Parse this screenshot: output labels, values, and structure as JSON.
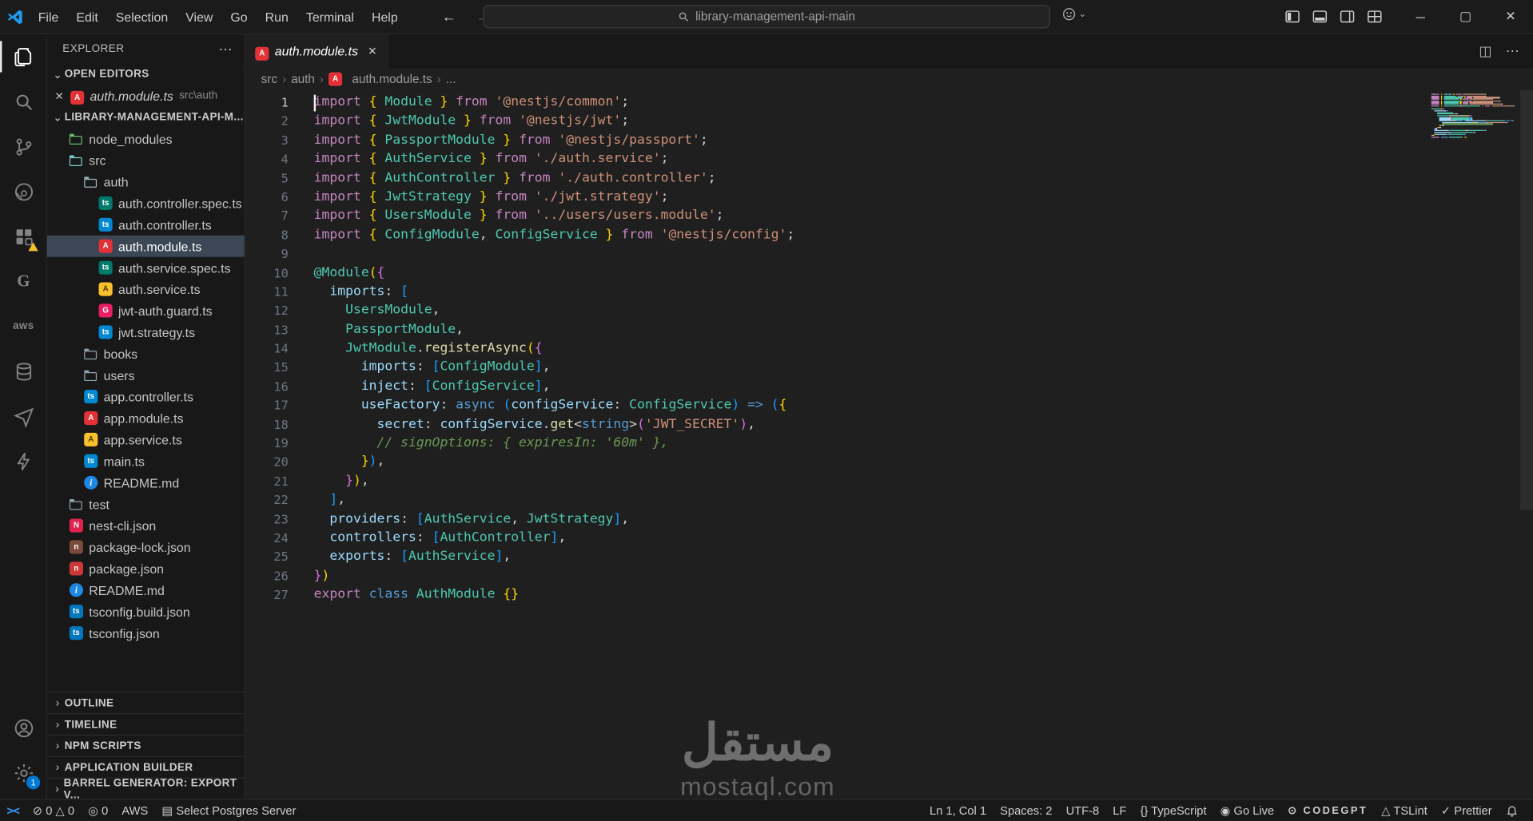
{
  "title_bar": {
    "menus": [
      "File",
      "Edit",
      "Selection",
      "View",
      "Go",
      "Run",
      "Terminal",
      "Help"
    ],
    "search_text": "library-management-api-main",
    "window_controls": {
      "minimize": "─",
      "maximize": "▢",
      "close": "✕"
    }
  },
  "icons": {
    "close": "✕",
    "more": "⋯",
    "chevron_down": "⌄",
    "chevron_right": "›",
    "back": "←",
    "forward": "→",
    "split_editor": "◫",
    "remote": "><"
  },
  "activity_bar": {
    "settings_badge": "1",
    "aws_label": "aws",
    "g_label": "G"
  },
  "sidebar": {
    "title": "EXPLORER",
    "open_editors": {
      "label": "OPEN EDITORS",
      "items": [
        {
          "name": "auth.module.ts",
          "path": "src\\auth",
          "icon": "ng-red"
        }
      ]
    },
    "project": {
      "label": "LIBRARY-MANAGEMENT-API-M...",
      "tree": [
        {
          "label": "node_modules",
          "icon": "folder-nm",
          "indent": 1
        },
        {
          "label": "src",
          "icon": "folder-src",
          "indent": 1
        },
        {
          "label": "auth",
          "icon": "folder-open",
          "indent": 2
        },
        {
          "label": "auth.controller.spec.ts",
          "icon": "ts-spec",
          "indent": 3
        },
        {
          "label": "auth.controller.ts",
          "icon": "ts-blue",
          "indent": 3
        },
        {
          "label": "auth.module.ts",
          "icon": "ng-red",
          "indent": 3,
          "selected": true
        },
        {
          "label": "auth.service.spec.ts",
          "icon": "ts-spec",
          "indent": 3
        },
        {
          "label": "auth.service.ts",
          "icon": "ng-yellow",
          "indent": 3
        },
        {
          "label": "jwt-auth.guard.ts",
          "icon": "ng-pink",
          "indent": 3
        },
        {
          "label": "jwt.strategy.ts",
          "icon": "ts-blue",
          "indent": 3
        },
        {
          "label": "books",
          "icon": "folder",
          "indent": 2
        },
        {
          "label": "users",
          "icon": "folder",
          "indent": 2
        },
        {
          "label": "app.controller.ts",
          "icon": "ts-blue",
          "indent": 2
        },
        {
          "label": "app.module.ts",
          "icon": "ng-red",
          "indent": 2
        },
        {
          "label": "app.service.ts",
          "icon": "ng-yellow",
          "indent": 2
        },
        {
          "label": "main.ts",
          "icon": "ts-blue",
          "indent": 2
        },
        {
          "label": "README.md",
          "icon": "info",
          "indent": 2
        },
        {
          "label": "test",
          "icon": "folder",
          "indent": 1
        },
        {
          "label": "nest-cli.json",
          "icon": "nest",
          "indent": 1
        },
        {
          "label": "package-lock.json",
          "icon": "npm-lock",
          "indent": 1
        },
        {
          "label": "package.json",
          "icon": "npm",
          "indent": 1
        },
        {
          "label": "README.md",
          "icon": "info",
          "indent": 1
        },
        {
          "label": "tsconfig.build.json",
          "icon": "tsconfig",
          "indent": 1
        },
        {
          "label": "tsconfig.json",
          "icon": "tsconfig",
          "indent": 1
        }
      ]
    },
    "bottom_panels": [
      "OUTLINE",
      "TIMELINE",
      "NPM SCRIPTS",
      "APPLICATION BUILDER",
      "BARREL GENERATOR: EXPORT V..."
    ]
  },
  "icon_defs": {
    "folder": {
      "type": "folder",
      "color": "#90a4ae"
    },
    "folder-nm": {
      "type": "folder",
      "color": "#66bb6a"
    },
    "folder-src": {
      "type": "folder",
      "color": "#81cfd1"
    },
    "folder-open": {
      "type": "folder",
      "color": "#9fb6c3"
    },
    "ng-red": {
      "type": "file",
      "bg": "#E23237",
      "glyph": "A",
      "fg": "#ffffff"
    },
    "ng-yellow": {
      "type": "file",
      "bg": "#FBC02D",
      "glyph": "A",
      "fg": "#4a3a00"
    },
    "ng-pink": {
      "type": "file",
      "bg": "#E91E63",
      "glyph": "G",
      "fg": "#ffffff"
    },
    "ts-blue": {
      "type": "file",
      "bg": "#0288D1",
      "glyph": "ts",
      "fg": "#ffffff"
    },
    "ts-spec": {
      "type": "file",
      "bg": "#00796B",
      "glyph": "ts",
      "fg": "#ffffff"
    },
    "info": {
      "type": "file",
      "bg": "#1E88E5",
      "glyph": "i",
      "fg": "#ffffff",
      "round": true
    },
    "nest": {
      "type": "file",
      "bg": "#E0234E",
      "glyph": "N",
      "fg": "#ffffff"
    },
    "npm": {
      "type": "file",
      "bg": "#CB3837",
      "glyph": "n",
      "fg": "#ffffff"
    },
    "npm-lock": {
      "type": "file",
      "bg": "#7A4A3A",
      "glyph": "n",
      "fg": "#ffffff"
    },
    "tsconfig": {
      "type": "file",
      "bg": "#0277BD",
      "glyph": "ts",
      "fg": "#ffffff"
    }
  },
  "editor": {
    "tab": {
      "label": "auth.module.ts",
      "close": "✕",
      "icon": "ng-red"
    },
    "breadcrumb": [
      {
        "label": "src"
      },
      {
        "label": "auth"
      },
      {
        "label": "auth.module.ts",
        "icon": "ng-red"
      },
      {
        "label": "..."
      }
    ],
    "code_lines": [
      [
        [
          "k",
          "import"
        ],
        [
          "p",
          " "
        ],
        [
          "b1",
          "{"
        ],
        [
          "p",
          " "
        ],
        [
          "t",
          "Module"
        ],
        [
          "p",
          " "
        ],
        [
          "b1",
          "}"
        ],
        [
          "p",
          " "
        ],
        [
          "k",
          "from"
        ],
        [
          "p",
          " "
        ],
        [
          "str",
          "'@nestjs/common'"
        ],
        [
          "p",
          ";"
        ]
      ],
      [
        [
          "k",
          "import"
        ],
        [
          "p",
          " "
        ],
        [
          "b1",
          "{"
        ],
        [
          "p",
          " "
        ],
        [
          "t",
          "JwtModule"
        ],
        [
          "p",
          " "
        ],
        [
          "b1",
          "}"
        ],
        [
          "p",
          " "
        ],
        [
          "k",
          "from"
        ],
        [
          "p",
          " "
        ],
        [
          "str",
          "'@nestjs/jwt'"
        ],
        [
          "p",
          ";"
        ]
      ],
      [
        [
          "k",
          "import"
        ],
        [
          "p",
          " "
        ],
        [
          "b1",
          "{"
        ],
        [
          "p",
          " "
        ],
        [
          "t",
          "PassportModule"
        ],
        [
          "p",
          " "
        ],
        [
          "b1",
          "}"
        ],
        [
          "p",
          " "
        ],
        [
          "k",
          "from"
        ],
        [
          "p",
          " "
        ],
        [
          "str",
          "'@nestjs/passport'"
        ],
        [
          "p",
          ";"
        ]
      ],
      [
        [
          "k",
          "import"
        ],
        [
          "p",
          " "
        ],
        [
          "b1",
          "{"
        ],
        [
          "p",
          " "
        ],
        [
          "t",
          "AuthService"
        ],
        [
          "p",
          " "
        ],
        [
          "b1",
          "}"
        ],
        [
          "p",
          " "
        ],
        [
          "k",
          "from"
        ],
        [
          "p",
          " "
        ],
        [
          "str",
          "'./auth.service'"
        ],
        [
          "p",
          ";"
        ]
      ],
      [
        [
          "k",
          "import"
        ],
        [
          "p",
          " "
        ],
        [
          "b1",
          "{"
        ],
        [
          "p",
          " "
        ],
        [
          "t",
          "AuthController"
        ],
        [
          "p",
          " "
        ],
        [
          "b1",
          "}"
        ],
        [
          "p",
          " "
        ],
        [
          "k",
          "from"
        ],
        [
          "p",
          " "
        ],
        [
          "str",
          "'./auth.controller'"
        ],
        [
          "p",
          ";"
        ]
      ],
      [
        [
          "k",
          "import"
        ],
        [
          "p",
          " "
        ],
        [
          "b1",
          "{"
        ],
        [
          "p",
          " "
        ],
        [
          "t",
          "JwtStrategy"
        ],
        [
          "p",
          " "
        ],
        [
          "b1",
          "}"
        ],
        [
          "p",
          " "
        ],
        [
          "k",
          "from"
        ],
        [
          "p",
          " "
        ],
        [
          "str",
          "'./jwt.strategy'"
        ],
        [
          "p",
          ";"
        ]
      ],
      [
        [
          "k",
          "import"
        ],
        [
          "p",
          " "
        ],
        [
          "b1",
          "{"
        ],
        [
          "p",
          " "
        ],
        [
          "t",
          "UsersModule"
        ],
        [
          "p",
          " "
        ],
        [
          "b1",
          "}"
        ],
        [
          "p",
          " "
        ],
        [
          "k",
          "from"
        ],
        [
          "p",
          " "
        ],
        [
          "str",
          "'../users/users.module'"
        ],
        [
          "p",
          ";"
        ]
      ],
      [
        [
          "k",
          "import"
        ],
        [
          "p",
          " "
        ],
        [
          "b1",
          "{"
        ],
        [
          "p",
          " "
        ],
        [
          "t",
          "ConfigModule"
        ],
        [
          "p",
          ", "
        ],
        [
          "t",
          "ConfigService"
        ],
        [
          "p",
          " "
        ],
        [
          "b1",
          "}"
        ],
        [
          "p",
          " "
        ],
        [
          "k",
          "from"
        ],
        [
          "p",
          " "
        ],
        [
          "str",
          "'@nestjs/config'"
        ],
        [
          "p",
          ";"
        ]
      ],
      [],
      [
        [
          "t",
          "@Module"
        ],
        [
          "b1",
          "("
        ],
        [
          "b2",
          "{"
        ]
      ],
      [
        [
          "p",
          "  "
        ],
        [
          "v",
          "imports"
        ],
        [
          "p",
          ": "
        ],
        [
          "b3",
          "["
        ]
      ],
      [
        [
          "p",
          "    "
        ],
        [
          "t",
          "UsersModule"
        ],
        [
          "p",
          ","
        ]
      ],
      [
        [
          "p",
          "    "
        ],
        [
          "t",
          "PassportModule"
        ],
        [
          "p",
          ","
        ]
      ],
      [
        [
          "p",
          "    "
        ],
        [
          "t",
          "JwtModule"
        ],
        [
          "p",
          "."
        ],
        [
          "f",
          "registerAsync"
        ],
        [
          "b1",
          "("
        ],
        [
          "b2",
          "{"
        ]
      ],
      [
        [
          "p",
          "      "
        ],
        [
          "v",
          "imports"
        ],
        [
          "p",
          ": "
        ],
        [
          "b3",
          "["
        ],
        [
          "t",
          "ConfigModule"
        ],
        [
          "b3",
          "]"
        ],
        [
          "p",
          ","
        ]
      ],
      [
        [
          "p",
          "      "
        ],
        [
          "v",
          "inject"
        ],
        [
          "p",
          ": "
        ],
        [
          "b3",
          "["
        ],
        [
          "t",
          "ConfigService"
        ],
        [
          "b3",
          "]"
        ],
        [
          "p",
          ","
        ]
      ],
      [
        [
          "p",
          "      "
        ],
        [
          "v",
          "useFactory"
        ],
        [
          "p",
          ": "
        ],
        [
          "s",
          "async"
        ],
        [
          "p",
          " "
        ],
        [
          "b3",
          "("
        ],
        [
          "v",
          "configService"
        ],
        [
          "p",
          ": "
        ],
        [
          "t",
          "ConfigService"
        ],
        [
          "b3",
          ")"
        ],
        [
          "p",
          " "
        ],
        [
          "s",
          "=>"
        ],
        [
          "p",
          " "
        ],
        [
          "b3",
          "("
        ],
        [
          "b1",
          "{"
        ]
      ],
      [
        [
          "p",
          "        "
        ],
        [
          "v",
          "secret"
        ],
        [
          "p",
          ": "
        ],
        [
          "v",
          "configService"
        ],
        [
          "p",
          "."
        ],
        [
          "f",
          "get"
        ],
        [
          "p",
          "<"
        ],
        [
          "s",
          "string"
        ],
        [
          "p",
          ">"
        ],
        [
          "b2",
          "("
        ],
        [
          "str",
          "'JWT_SECRET'"
        ],
        [
          "b2",
          ")"
        ],
        [
          "p",
          ","
        ]
      ],
      [
        [
          "p",
          "        "
        ],
        [
          "c",
          "// signOptions: { expiresIn: '60m' },"
        ]
      ],
      [
        [
          "p",
          "      "
        ],
        [
          "b1",
          "}"
        ],
        [
          "b3",
          ")"
        ],
        [
          "p",
          ","
        ]
      ],
      [
        [
          "p",
          "    "
        ],
        [
          "b2",
          "}"
        ],
        [
          "b1",
          ")"
        ],
        [
          "p",
          ","
        ]
      ],
      [
        [
          "p",
          "  "
        ],
        [
          "b3",
          "]"
        ],
        [
          "p",
          ","
        ]
      ],
      [
        [
          "p",
          "  "
        ],
        [
          "v",
          "providers"
        ],
        [
          "p",
          ": "
        ],
        [
          "b3",
          "["
        ],
        [
          "t",
          "AuthService"
        ],
        [
          "p",
          ", "
        ],
        [
          "t",
          "JwtStrategy"
        ],
        [
          "b3",
          "]"
        ],
        [
          "p",
          ","
        ]
      ],
      [
        [
          "p",
          "  "
        ],
        [
          "v",
          "controllers"
        ],
        [
          "p",
          ": "
        ],
        [
          "b3",
          "["
        ],
        [
          "t",
          "AuthController"
        ],
        [
          "b3",
          "]"
        ],
        [
          "p",
          ","
        ]
      ],
      [
        [
          "p",
          "  "
        ],
        [
          "v",
          "exports"
        ],
        [
          "p",
          ": "
        ],
        [
          "b3",
          "["
        ],
        [
          "t",
          "AuthService"
        ],
        [
          "b3",
          "]"
        ],
        [
          "p",
          ","
        ]
      ],
      [
        [
          "b2",
          "}"
        ],
        [
          "b1",
          ")"
        ]
      ],
      [
        [
          "k",
          "export"
        ],
        [
          "p",
          " "
        ],
        [
          "s",
          "class"
        ],
        [
          "p",
          " "
        ],
        [
          "t",
          "AuthModule"
        ],
        [
          "p",
          " "
        ],
        [
          "b1",
          "{}"
        ]
      ]
    ]
  },
  "status_bar": {
    "left": [
      {
        "name": "remote-indicator",
        "text": "><"
      },
      {
        "name": "problems",
        "text": "⊘ 0  △ 0"
      },
      {
        "name": "ports",
        "text": "◎ 0"
      },
      {
        "name": "aws",
        "text": "AWS"
      },
      {
        "name": "postgres-server",
        "text": "▤ Select Postgres Server"
      }
    ],
    "right": [
      {
        "name": "cursor-position",
        "text": "Ln 1, Col 1"
      },
      {
        "name": "indentation",
        "text": "Spaces: 2"
      },
      {
        "name": "encoding",
        "text": "UTF-8"
      },
      {
        "name": "eol",
        "text": "LF"
      },
      {
        "name": "language-mode",
        "text": "{} TypeScript"
      },
      {
        "name": "go-live",
        "text": "◉ Go Live"
      },
      {
        "name": "codegpt",
        "text": "⊙  CODEGPT"
      },
      {
        "name": "tslint",
        "text": "△ TSLint"
      },
      {
        "name": "prettier",
        "text": "✓ Prettier"
      }
    ]
  },
  "watermark": {
    "arabic": "مستقل",
    "latin": "mostaql.com"
  }
}
